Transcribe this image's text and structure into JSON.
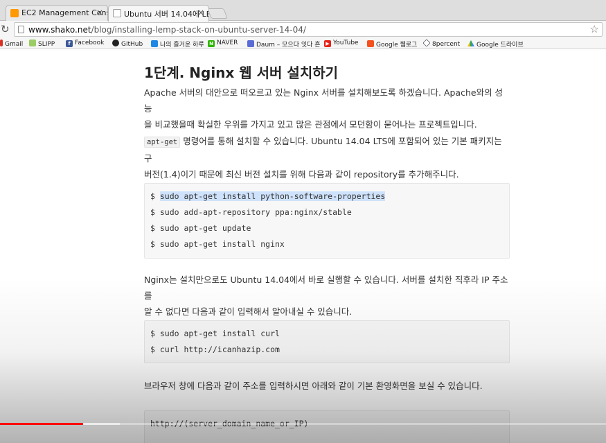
{
  "tabs": [
    {
      "title": "EC2 Management Console",
      "icon": "aws-icon",
      "close": "×"
    },
    {
      "title": "Ubuntu 서버 14.04에 LEMP",
      "icon": "page-icon",
      "close": "×"
    }
  ],
  "address_bar": {
    "domain": "www.shako.net",
    "path": "/blog/installing-lemp-stack-on-ubuntu-server-14-04/"
  },
  "bookmarks": [
    {
      "label": "Gmail",
      "icon": "gmail-icon"
    },
    {
      "label": "SLIPP",
      "icon": "slipp-icon"
    },
    {
      "label": "Facebook",
      "icon": "facebook-icon"
    },
    {
      "label": "GitHub",
      "icon": "github-icon"
    },
    {
      "label": "나의 즐거운 하루",
      "icon": "bookmark-icon"
    },
    {
      "label": "NAVER",
      "icon": "naver-icon"
    },
    {
      "label": "Daum – 모으다 잇다 흔",
      "icon": "daum-icon"
    },
    {
      "label": "YouTube",
      "icon": "youtube-icon"
    },
    {
      "label": "Google 웹로그",
      "icon": "google-icon"
    },
    {
      "label": "8percent",
      "icon": "8percent-icon"
    },
    {
      "label": "Google 드라이브",
      "icon": "drive-icon"
    }
  ],
  "article": {
    "heading": "1단계. Nginx 웹 서버 설치하기",
    "para1_line1": "Apache 서버의 대안으로 떠오르고 있는 Nginx 서버를 설치해보도록 하겠습니다. Apache와의 성능",
    "para1_line2": "을 비교했을때 확실한 우위를 가지고 있고 많은 관점에서 모던함이 묻어나는 프로젝트입니다.",
    "para2_code": "apt-get",
    "para2_line1": " 명령어를 통해 설치할 수 있습니다. Ubuntu 14.04 LTS에 포함되어 있는 기본 패키지는 구",
    "para2_line2": "버전(1.4)이기 때문에 최신 버전 설치를 위해 다음과 같이 repository를 추가해주니다.",
    "code1": {
      "prompt": "$ ",
      "line1": "sudo apt-get install python-software-properties",
      "line2": "$ sudo add-apt-repository ppa:nginx/stable",
      "line3": "$ sudo apt-get update",
      "line4": "$ sudo apt-get install nginx"
    },
    "para3_line1": "Nginx는 설치만으로도 Ubuntu 14.04에서 바로 실행할 수 있습니다. 서버를 설치한 직후라 IP 주소를",
    "para3_line2": "알 수 없다면 다음과 같이 입력해서 알아내실 수 있습니다.",
    "code2": {
      "line1": "$ sudo apt-get install curl",
      "line2": "$ curl http://icanhazip.com"
    },
    "para4": "브라우저 창에 다음과 같이 주소를 입력하시면 아래와 같이 기본 환영화면을 보실 수 있습니다.",
    "code3": {
      "line1": "http://(server_domain_name_or_IP)"
    }
  },
  "video_progress": {
    "played_fraction": 0.137,
    "color": "#ff0000"
  }
}
